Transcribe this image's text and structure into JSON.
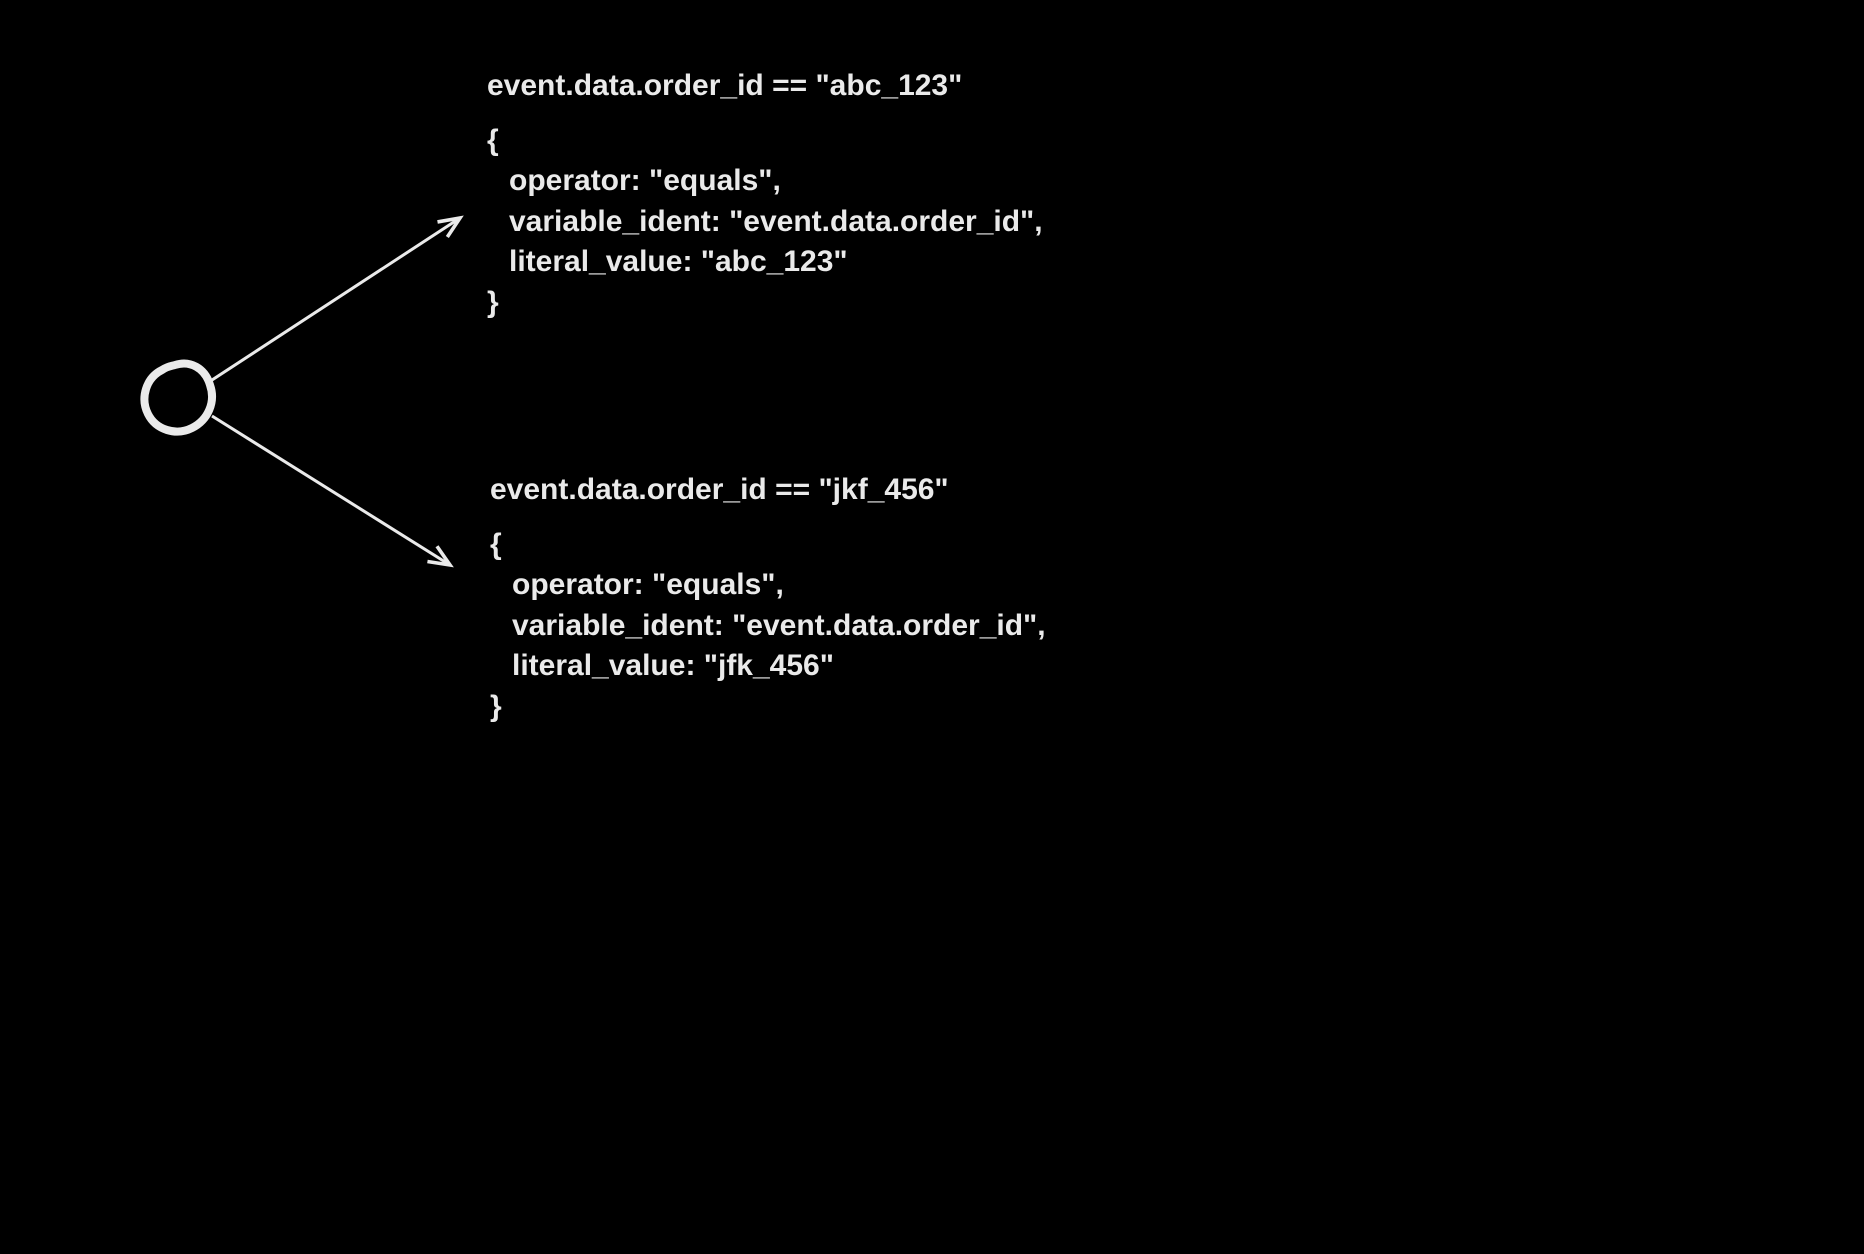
{
  "top": {
    "expression": "event.data.order_id == \"abc_123\"",
    "brace_open": "{",
    "line_operator": "operator: \"equals\",",
    "line_variable": "variable_ident: \"event.data.order_id\",",
    "line_literal": "literal_value: \"abc_123\"",
    "brace_close": "}"
  },
  "bottom": {
    "expression": "event.data.order_id == \"jkf_456\"",
    "brace_open": "{",
    "line_operator": "operator: \"equals\",",
    "line_variable": "variable_ident: \"event.data.order_id\",",
    "line_literal": "literal_value: \"jfk_456\"",
    "brace_close": "}"
  }
}
